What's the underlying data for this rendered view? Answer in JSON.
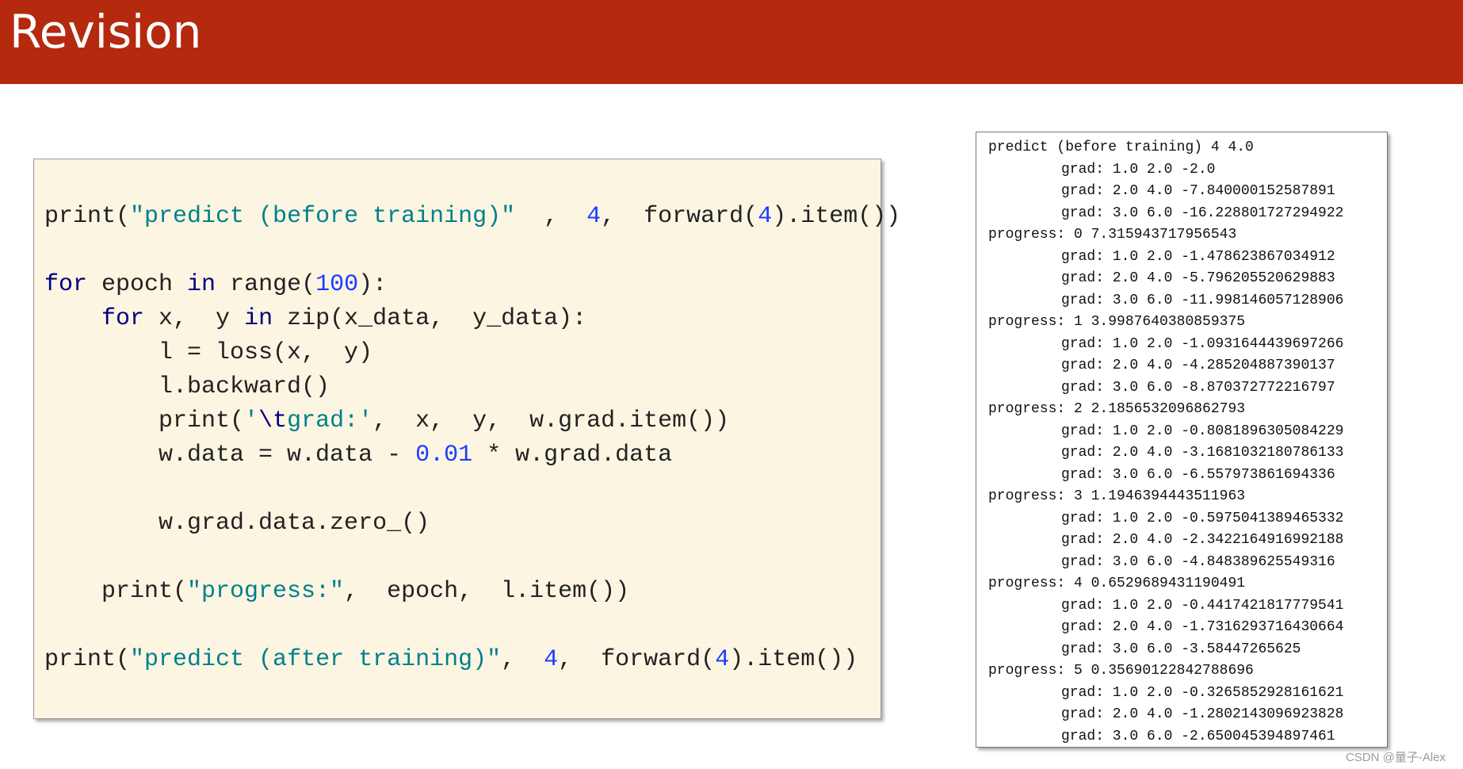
{
  "header": {
    "title": "Revision",
    "color": "#b5290f"
  },
  "code": {
    "lines": [
      [
        [
          "fn",
          "print("
        ],
        [
          "str",
          "\"predict (before training)\""
        ],
        [
          "",
          "  ,  "
        ],
        [
          "num",
          "4"
        ],
        [
          "",
          ",  forward("
        ],
        [
          "num",
          "4"
        ],
        [
          "",
          ").item())"
        ]
      ],
      [],
      [
        [
          "kw",
          "for"
        ],
        [
          "",
          " epoch "
        ],
        [
          "kw",
          "in"
        ],
        [
          "",
          " range("
        ],
        [
          "num",
          "100"
        ],
        [
          "",
          "):"
        ]
      ],
      [
        [
          "",
          "    "
        ],
        [
          "kw",
          "for"
        ],
        [
          "",
          " x,  y "
        ],
        [
          "kw",
          "in"
        ],
        [
          "",
          " zip(x_data,  y_data):"
        ]
      ],
      [
        [
          "",
          "        l = loss(x,  y)"
        ]
      ],
      [
        [
          "",
          "        l.backward()"
        ]
      ],
      [
        [
          "",
          "        print("
        ],
        [
          "str",
          "'"
        ],
        [
          "esc",
          "\\t"
        ],
        [
          "str",
          "grad:'"
        ],
        [
          "",
          ",  x,  y,  w.grad.item())"
        ]
      ],
      [
        [
          "",
          "        w.data = w.data - "
        ],
        [
          "num",
          "0.01"
        ],
        [
          "",
          " * w.grad.data"
        ]
      ],
      [],
      [
        [
          "",
          "        w.grad.data.zero_()"
        ]
      ],
      [],
      [
        [
          "",
          "    print("
        ],
        [
          "str",
          "\"progress:\""
        ],
        [
          "",
          ",  epoch,  l.item())"
        ]
      ],
      [],
      [
        [
          "",
          "print("
        ],
        [
          "str",
          "\"predict (after training)\""
        ],
        [
          "",
          ",  "
        ],
        [
          "num",
          "4"
        ],
        [
          "",
          ",  forward("
        ],
        [
          "num",
          "4"
        ],
        [
          "",
          ").item())"
        ]
      ]
    ]
  },
  "output": {
    "lines": [
      "predict (before training) 4 4.0",
      "grad: 1.0 2.0 -2.0",
      "grad: 2.0 4.0 -7.840000152587891",
      "grad: 3.0 6.0 -16.228801727294922",
      "progress: 0 7.315943717956543",
      "grad: 1.0 2.0 -1.478623867034912",
      "grad: 2.0 4.0 -5.796205520629883",
      "grad: 3.0 6.0 -11.998146057128906",
      "progress: 1 3.9987640380859375",
      "grad: 1.0 2.0 -1.0931644439697266",
      "grad: 2.0 4.0 -4.285204887390137",
      "grad: 3.0 6.0 -8.870372772216797",
      "progress: 2 2.1856532096862793",
      "grad: 1.0 2.0 -0.8081896305084229",
      "grad: 2.0 4.0 -3.1681032180786133",
      "grad: 3.0 6.0 -6.557973861694336",
      "progress: 3 1.1946394443511963",
      "grad: 1.0 2.0 -0.5975041389465332",
      "grad: 2.0 4.0 -2.3422164916992188",
      "grad: 3.0 6.0 -4.848389625549316",
      "progress: 4 0.6529689431190491",
      "grad: 1.0 2.0 -0.4417421817779541",
      "grad: 2.0 4.0 -1.7316293716430664",
      "grad: 3.0 6.0 -3.58447265625",
      "progress: 5 0.35690122842788696",
      "grad: 1.0 2.0 -0.3265852928161621",
      "grad: 2.0 4.0 -1.2802143096923828",
      "grad: 3.0 6.0 -2.650045394897461"
    ]
  },
  "watermark": "CSDN @量子-Alex"
}
